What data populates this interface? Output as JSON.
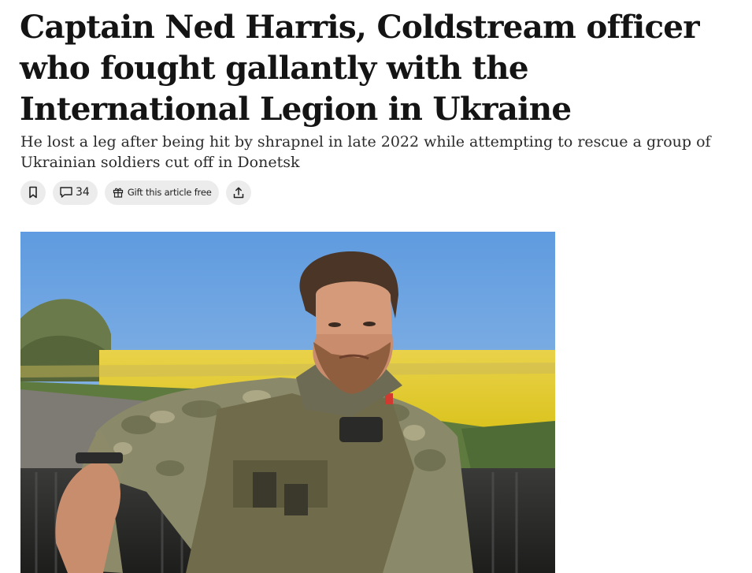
{
  "article": {
    "headline": "Captain Ned Harris, Coldstream officer who fought gallantly with the International Legion in Ukraine",
    "standfirst": "He lost a leg after being hit by shrapnel in late 2022 while attempting to rescue a group of Ukrainian soldiers cut off in Donetsk"
  },
  "actions": {
    "bookmark_icon": "bookmark-icon",
    "comment_icon": "speech-bubble-icon",
    "comment_count": "34",
    "gift_icon": "gift-icon",
    "gift_label": "Gift this article free",
    "share_icon": "share-upload-icon"
  },
  "image": {
    "subject": "photo-soldier-in-camouflage-before-rapeseed-field"
  },
  "colors": {
    "text": "#141414",
    "pill_background": "#ececec",
    "sky": "#6fa6df",
    "field": "#ecd41f"
  }
}
